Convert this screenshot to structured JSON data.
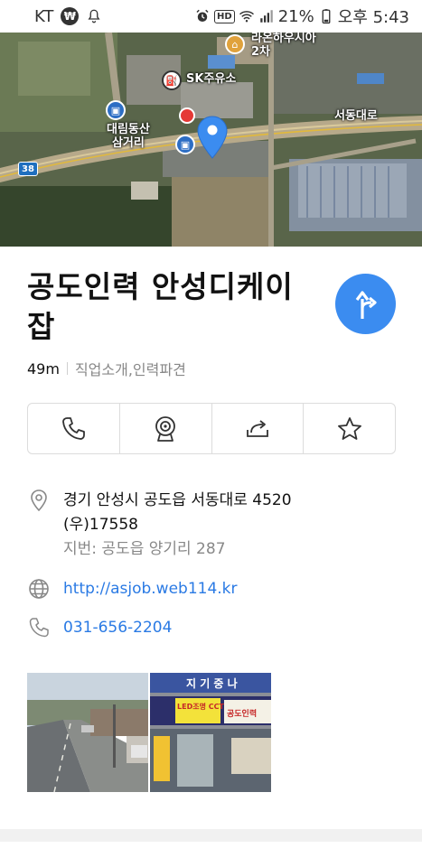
{
  "status_bar": {
    "carrier": "KT",
    "battery_percent": "21%",
    "time": "오후 5:43",
    "hd_label": "HD"
  },
  "map": {
    "labels": {
      "sk_station": "SK주유소",
      "road": "서동대로",
      "bus_stop": "대림동산\n삼거리",
      "top_poi": "라온하우시아\n2차",
      "route_number": "38"
    },
    "colors": {
      "pin": "#3b8cf0",
      "red_marker": "#e53935"
    }
  },
  "place": {
    "title": "공도인력 안성디케이잡",
    "distance": "49m",
    "category": "직업소개,인력파견"
  },
  "actions": [
    {
      "name": "call",
      "icon": "phone-icon"
    },
    {
      "name": "street-view",
      "icon": "roadview-icon"
    },
    {
      "name": "share",
      "icon": "share-icon"
    },
    {
      "name": "save",
      "icon": "star-icon"
    }
  ],
  "info": {
    "address": "경기 안성시 공도읍 서동대로 4520",
    "postal": "(우)17558",
    "lot_address": "지번: 공도읍 양기리 287",
    "website": "http://asjob.web114.kr",
    "phone": "031-656-2204"
  },
  "photo_captions": {
    "shop_sign_1": "지 기 중 나",
    "shop_sign_2": "LED조명 CCTV전문",
    "shop_sign_3": "공도인력"
  },
  "colors": {
    "accent": "#3b8cf0",
    "link": "#2a7ae4"
  }
}
